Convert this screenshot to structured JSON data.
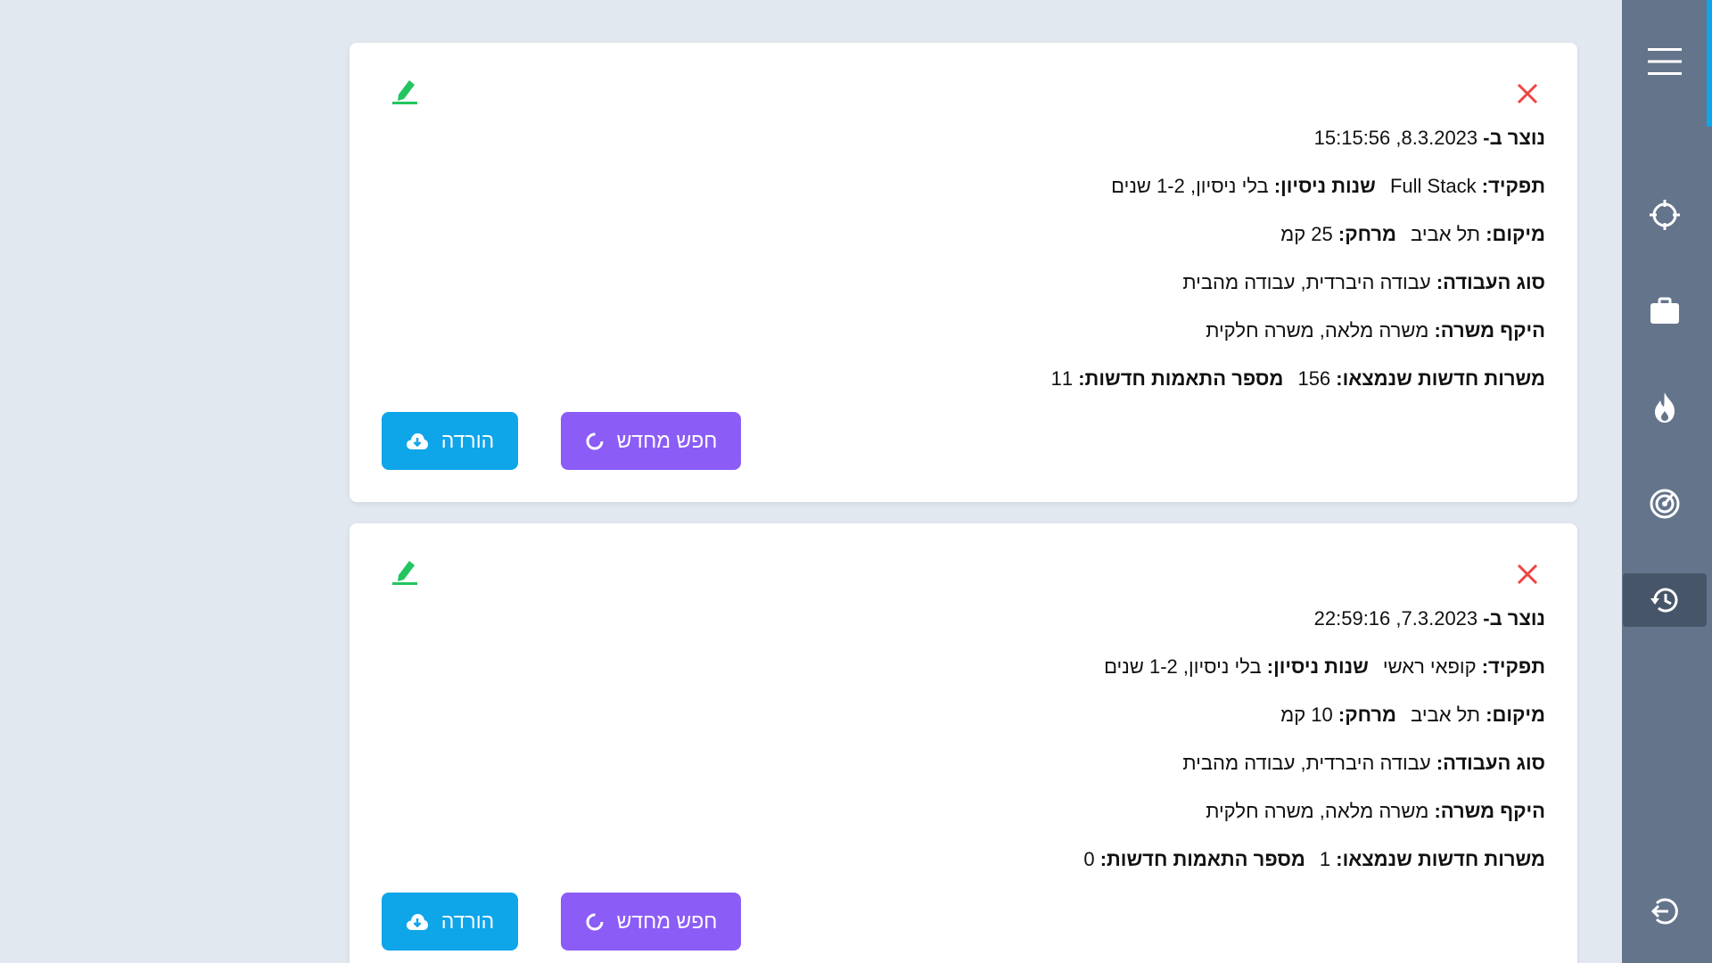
{
  "colors": {
    "background": "#e2e8f0",
    "sidebar": "#64748b",
    "sidebar_active": "#475569",
    "accent": "#0ea5e9",
    "close_icon": "#ef4444",
    "edit_icon": "#22c55e",
    "download_button": "#0ea5e9",
    "research_button": "#8b5cf6"
  },
  "sidebar": {
    "items": [
      {
        "icon": "menu-icon",
        "active": false
      },
      {
        "icon": "crosshair-icon",
        "active": false
      },
      {
        "icon": "briefcase-icon",
        "active": false
      },
      {
        "icon": "fire-icon",
        "active": false
      },
      {
        "icon": "radar-icon",
        "active": false
      },
      {
        "icon": "history-icon",
        "active": true
      },
      {
        "icon": "logout-icon",
        "active": false
      }
    ]
  },
  "labels": {
    "created_at": "נוצר ב-",
    "role": "תפקיד:",
    "experience": "שנות ניסיון:",
    "location": "מיקום:",
    "distance": "מרחק:",
    "work_type": "סוג העבודה:",
    "job_scope": "היקף משרה:",
    "new_jobs": "משרות חדשות שנמצאו:",
    "new_matches": "מספר התאמות חדשות:",
    "download_button": "הורדה",
    "research_button": "חפש מחדש"
  },
  "searches": [
    {
      "created_at": "8.3.2023, 15:15:56",
      "role": "Full Stack",
      "experience": "בלי ניסיון, 1-2 שנים",
      "location": "תל אביב",
      "distance": "25 קמ",
      "work_type": "עבודה היברדית, עבודה מהבית",
      "job_scope": "משרה מלאה, משרה חלקית",
      "new_jobs": "156",
      "new_matches": "11"
    },
    {
      "created_at": "7.3.2023, 22:59:16",
      "role": "קופאי ראשי",
      "experience": "בלי ניסיון, 1-2 שנים",
      "location": "תל אביב",
      "distance": "10 קמ",
      "work_type": "עבודה היברדית, עבודה מהבית",
      "job_scope": "משרה מלאה, משרה חלקית",
      "new_jobs": "1",
      "new_matches": "0"
    }
  ]
}
